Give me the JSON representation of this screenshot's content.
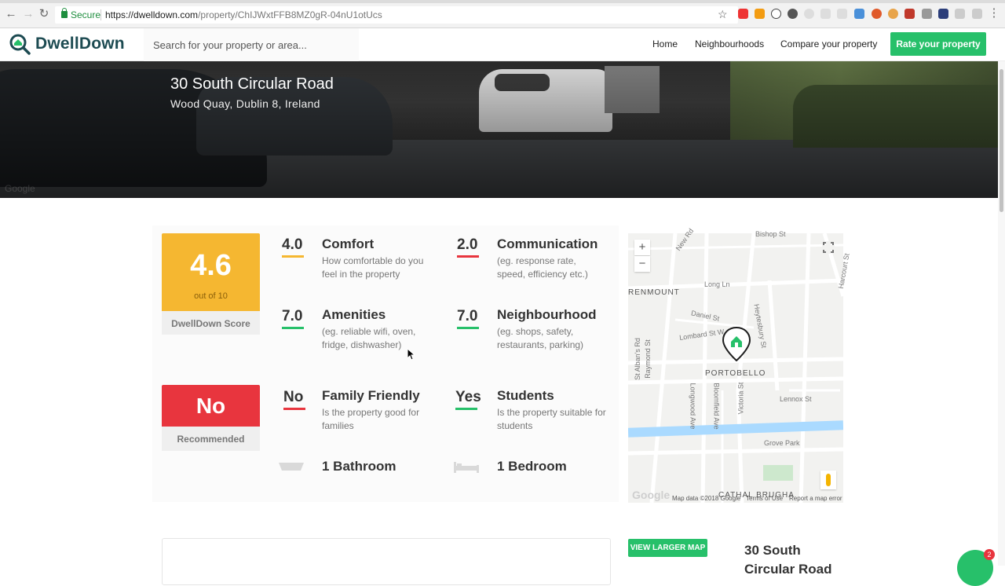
{
  "browser": {
    "secure_label": "Secure",
    "url_host": "https://dwelldown.com",
    "url_path": "/property/ChIJWxtFFB8MZ0gR-04nU1otUcs"
  },
  "header": {
    "logo_text": "DwellDown",
    "search_placeholder": "Search for your property or area...",
    "nav": [
      "Home",
      "Neighbourhoods",
      "Compare your property"
    ],
    "cta": "Rate your property",
    "accent": "#27c06a"
  },
  "hero": {
    "title": "30 South Circular Road",
    "subtitle": "Wood Quay, Dublin 8, Ireland",
    "watermark": "Google"
  },
  "score": {
    "value": "4.6",
    "out_of": "out of 10",
    "label": "DwellDown Score",
    "color": "#f5b731"
  },
  "recommend": {
    "value": "No",
    "label": "Recommended",
    "color": "#e8353e"
  },
  "metrics": [
    {
      "value": "4.0",
      "name": "Comfort",
      "desc": "How comfortable do you feel in the property",
      "bar_color": "#f5b731"
    },
    {
      "value": "2.0",
      "name": "Communication",
      "desc": "(eg. response rate, speed, efficiency etc.)",
      "bar_color": "#e8353e"
    },
    {
      "value": "7.0",
      "name": "Amenities",
      "desc": "(eg. reliable wifi, oven, fridge, dishwasher)",
      "bar_color": "#27c06a"
    },
    {
      "value": "7.0",
      "name": "Neighbourhood",
      "desc": "(eg. shops, safety, restaurants, parking)",
      "bar_color": "#27c06a"
    },
    {
      "value": "No",
      "name": "Family Friendly",
      "desc": "Is the property good for families",
      "bar_color": "#e8353e"
    },
    {
      "value": "Yes",
      "name": "Students",
      "desc": "Is the property suitable for students",
      "bar_color": "#27c06a"
    }
  ],
  "facts": [
    {
      "icon": "bathtub-icon",
      "text": "1 Bathroom"
    },
    {
      "icon": "bed-icon",
      "text": "1 Bedroom"
    }
  ],
  "map": {
    "zoom_in": "+",
    "zoom_out": "−",
    "area_label": "PORTOBELLO",
    "area_left": "RENMOUNT",
    "area_bottom": "CATHAL BRUGHA",
    "streets": [
      "New Rd",
      "Bishop St",
      "Harcourt St",
      "Long Ln",
      "Daniel St",
      "Lombard St W",
      "Heytesbury St",
      "St Alban's Rd",
      "Raymond St",
      "Longwood Ave",
      "Bloomfield Ave",
      "Victoria St",
      "Lennox St",
      "Grove Park"
    ],
    "google": "Google",
    "attribution": "Map data ©2018 Google",
    "terms": "Terms of Use",
    "report": "Report a map error"
  },
  "bottom": {
    "view_map": "VIEW LARGER MAP",
    "title": "30 South Circular Road"
  },
  "chat": {
    "badge": "2"
  }
}
